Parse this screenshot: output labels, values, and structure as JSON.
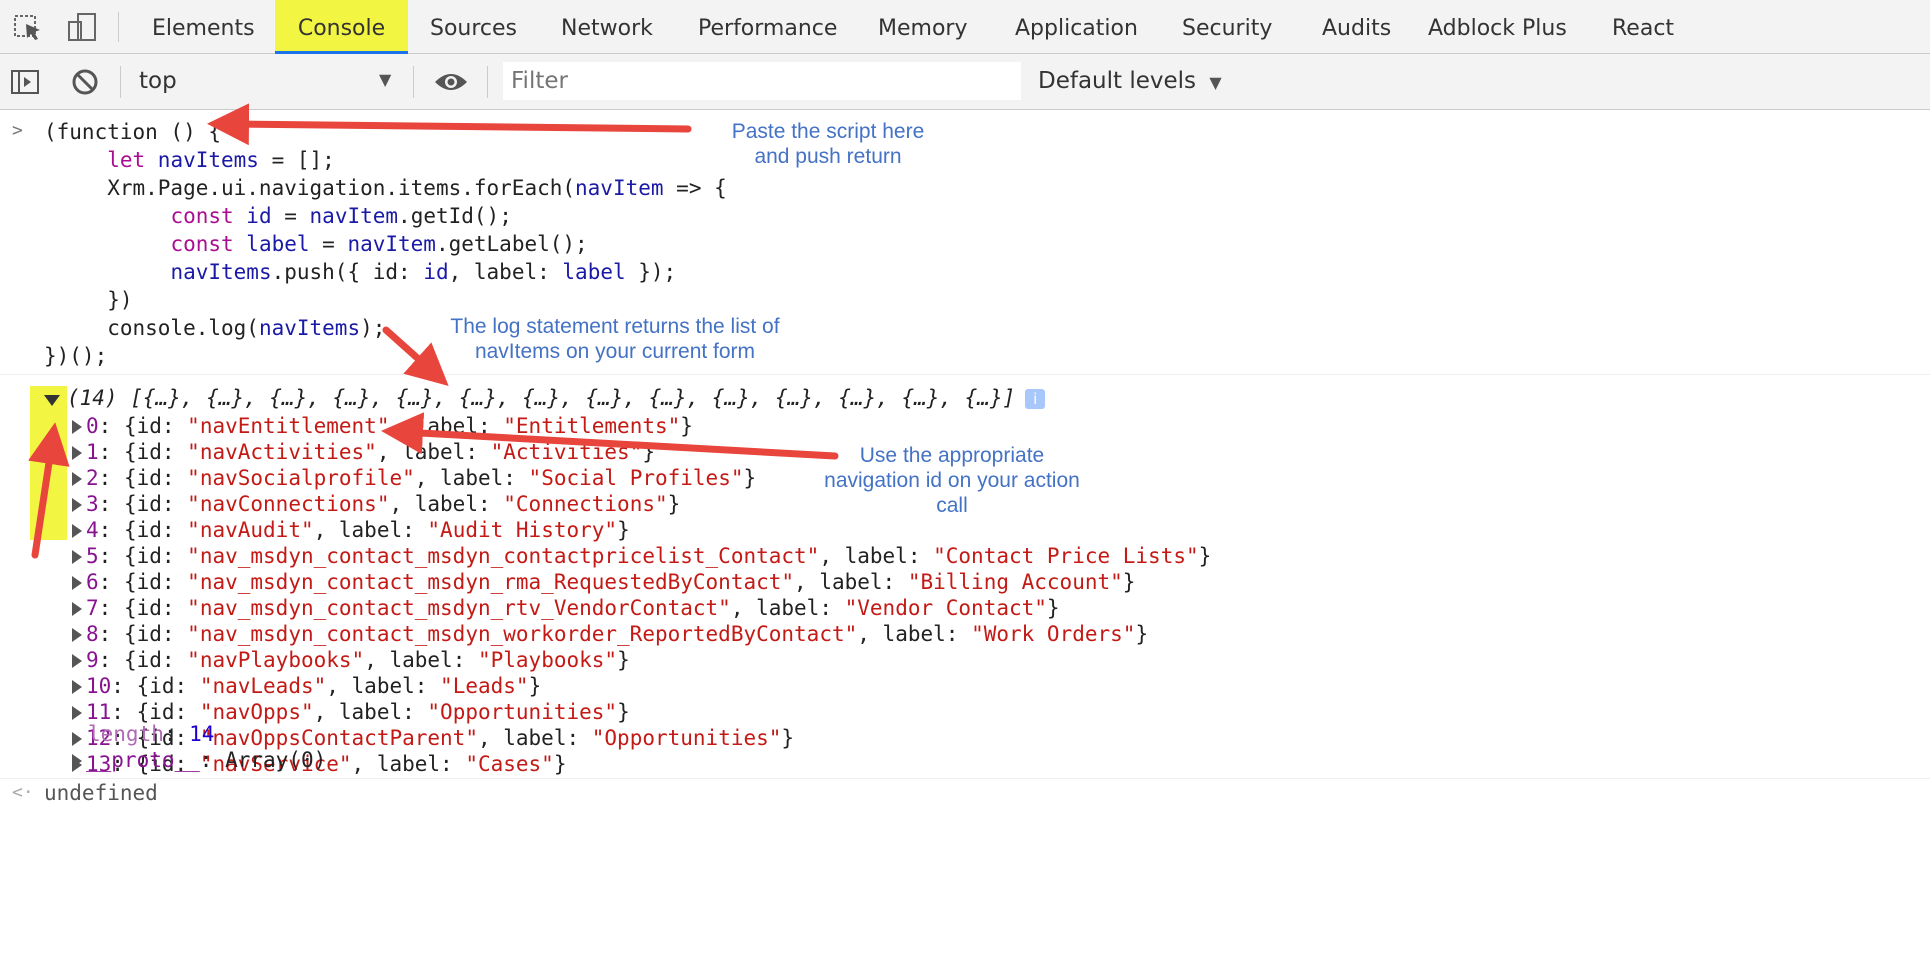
{
  "tabs": [
    {
      "label": "Elements"
    },
    {
      "label": "Console"
    },
    {
      "label": "Sources"
    },
    {
      "label": "Network"
    },
    {
      "label": "Performance"
    },
    {
      "label": "Memory"
    },
    {
      "label": "Application"
    },
    {
      "label": "Security"
    },
    {
      "label": "Audits"
    },
    {
      "label": "Adblock Plus"
    },
    {
      "label": "React"
    }
  ],
  "active_tab": "Console",
  "toolbar": {
    "context": "top",
    "filter_placeholder": "Filter",
    "levels": "Default levels"
  },
  "code": {
    "l1": "(function () {",
    "l2a": "let ",
    "l2b": "navItems",
    "l2c": " = [];",
    "l3a": "Xrm.Page.ui.navigation.items.forEach(",
    "l3b": "navItem",
    "l3c": " => {",
    "l4a": "const ",
    "l4b": "id",
    "l4c": " = ",
    "l4d": "navItem",
    "l4e": ".getId();",
    "l5a": "const ",
    "l5b": "label",
    "l5c": " = ",
    "l5d": "navItem",
    "l5e": ".getLabel();",
    "l6a": "navItems",
    "l6b": ".push({ id: ",
    "l6c": "id",
    "l6d": ", label: ",
    "l6e": "label",
    "l6f": " });",
    "l7": "})",
    "l8a": "console.log(",
    "l8b": "navItems",
    "l8c": ");",
    "l9": "})();"
  },
  "result": {
    "summary": "(14) [{…}, {…}, {…}, {…}, {…}, {…}, {…}, {…}, {…}, {…}, {…}, {…}, {…}, {…}]",
    "info": "i",
    "items": [
      {
        "index": "0",
        "id": "\"navEntitlement\"",
        "label": "\"Entitlements\""
      },
      {
        "index": "1",
        "id": "\"navActivities\"",
        "label": "\"Activities\""
      },
      {
        "index": "2",
        "id": "\"navSocialprofile\"",
        "label": "\"Social Profiles\""
      },
      {
        "index": "3",
        "id": "\"navConnections\"",
        "label": "\"Connections\""
      },
      {
        "index": "4",
        "id": "\"navAudit\"",
        "label": "\"Audit History\""
      },
      {
        "index": "5",
        "id": "\"nav_msdyn_contact_msdyn_contactpricelist_Contact\"",
        "label": "\"Contact Price Lists\""
      },
      {
        "index": "6",
        "id": "\"nav_msdyn_contact_msdyn_rma_RequestedByContact\"",
        "label": "\"Billing Account\""
      },
      {
        "index": "7",
        "id": "\"nav_msdyn_contact_msdyn_rtv_VendorContact\"",
        "label": "\"Vendor Contact\""
      },
      {
        "index": "8",
        "id": "\"nav_msdyn_contact_msdyn_workorder_ReportedByContact\"",
        "label": "\"Work Orders\""
      },
      {
        "index": "9",
        "id": "\"navPlaybooks\"",
        "label": "\"Playbooks\""
      },
      {
        "index": "10",
        "id": "\"navLeads\"",
        "label": "\"Leads\""
      },
      {
        "index": "11",
        "id": "\"navOpps\"",
        "label": "\"Opportunities\""
      },
      {
        "index": "12",
        "id": "\"navOppsContactParent\"",
        "label": "\"Opportunities\""
      },
      {
        "index": "13",
        "id": "\"navService\"",
        "label": "\"Cases\""
      }
    ],
    "length_key": "length",
    "length_value": "14",
    "proto_key": "__proto__",
    "proto_value": "Array(0)"
  },
  "undefined_text": "undefined",
  "annotations": {
    "paste": [
      "Paste the script here",
      "and push return"
    ],
    "log": [
      "The log statement returns the list of",
      "navItems on your current form"
    ],
    "use": [
      "Use the appropriate",
      "navigation id on your action",
      "call"
    ]
  },
  "colors": {
    "highlight": "#f2f542",
    "arrow": "#e8453c",
    "note": "#4472c4"
  },
  "icons": [
    "inspect-icon",
    "device-toggle-icon",
    "sidebar-toggle-icon",
    "clear-console-icon",
    "eye-icon"
  ]
}
